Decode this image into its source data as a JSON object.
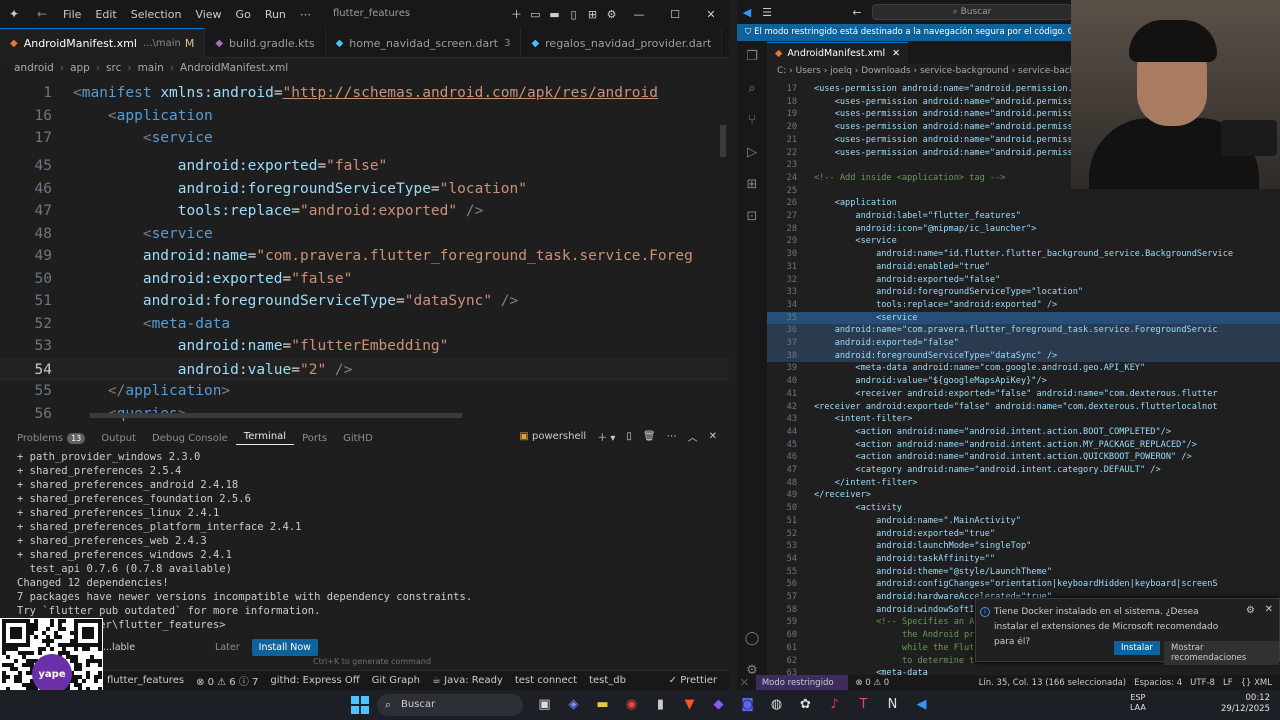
{
  "left_window": {
    "menu": [
      "File",
      "Edit",
      "Selection",
      "View",
      "Go",
      "Run",
      "⋯"
    ],
    "title": "flutter_features",
    "tabs": [
      {
        "label": "AndroidManifest.xml",
        "desc": "...\\main",
        "mod": "M"
      },
      {
        "label": "build.gradle.kts",
        "desc": "",
        "mod": ""
      },
      {
        "label": "home_navidad_screen.dart",
        "desc": "",
        "mod": "3"
      },
      {
        "label": "regalos_navidad_provider.dart",
        "desc": "",
        "mod": ""
      }
    ],
    "breadcrumb": [
      "android",
      "app",
      "src",
      "main",
      "AndroidManifest.xml"
    ],
    "code_lines": [
      {
        "n": "1",
        "parts": [
          [
            "t",
            "<"
          ],
          [
            "tag",
            "manifest "
          ],
          [
            "attr",
            "xmlns:android"
          ],
          [
            "eq",
            "="
          ],
          [
            "url",
            "\"http://schemas.android.com/apk/res/android"
          ]
        ]
      },
      {
        "n": "16",
        "parts": [
          [
            "t",
            "    <"
          ],
          [
            "tag",
            "application"
          ]
        ]
      },
      {
        "n": "17",
        "parts": [
          [
            "t",
            "        <"
          ],
          [
            "tag",
            "service"
          ]
        ]
      },
      {
        "n": "45",
        "parts": [
          [
            "attr",
            "            android:exported"
          ],
          [
            "eq",
            "="
          ],
          [
            "str",
            "\"false\""
          ]
        ]
      },
      {
        "n": "46",
        "parts": [
          [
            "attr",
            "            android:foregroundServiceType"
          ],
          [
            "eq",
            "="
          ],
          [
            "str",
            "\"location\""
          ]
        ]
      },
      {
        "n": "47",
        "parts": [
          [
            "attr",
            "            tools:replace"
          ],
          [
            "eq",
            "="
          ],
          [
            "str",
            "\"android:exported\""
          ],
          [
            "t",
            " />"
          ]
        ]
      },
      {
        "n": "48",
        "parts": [
          [
            "t",
            "        <"
          ],
          [
            "tag",
            "service"
          ]
        ]
      },
      {
        "n": "49",
        "parts": [
          [
            "attr",
            "        android:name"
          ],
          [
            "eq",
            "="
          ],
          [
            "str",
            "\"com.pravera.flutter_foreground_task.service.Foreg"
          ]
        ]
      },
      {
        "n": "50",
        "parts": [
          [
            "attr",
            "        android:exported"
          ],
          [
            "eq",
            "="
          ],
          [
            "str",
            "\"false\""
          ]
        ]
      },
      {
        "n": "51",
        "parts": [
          [
            "attr",
            "        android:foregroundServiceType"
          ],
          [
            "eq",
            "="
          ],
          [
            "str",
            "\"dataSync\""
          ],
          [
            "t",
            " />"
          ]
        ]
      },
      {
        "n": "52",
        "parts": [
          [
            "t",
            "        <"
          ],
          [
            "tag",
            "meta-data"
          ]
        ]
      },
      {
        "n": "53",
        "parts": [
          [
            "attr",
            "            android:name"
          ],
          [
            "eq",
            "="
          ],
          [
            "str",
            "\"flutterEmbedding\""
          ]
        ]
      },
      {
        "n": "54",
        "parts": [
          [
            "attr",
            "            android:value"
          ],
          [
            "eq",
            "="
          ],
          [
            "str",
            "\"2\""
          ],
          [
            "t",
            " />"
          ]
        ]
      },
      {
        "n": "55",
        "parts": [
          [
            "t",
            "    </"
          ],
          [
            "tag",
            "application"
          ],
          [
            "t",
            ">"
          ]
        ]
      },
      {
        "n": "56",
        "parts": [
          [
            "t",
            "    <"
          ],
          [
            "tag",
            "queries"
          ],
          [
            "t",
            ">"
          ]
        ]
      }
    ],
    "panel_tabs": [
      {
        "label": "Problems",
        "badge": "13"
      },
      {
        "label": "Output",
        "badge": ""
      },
      {
        "label": "Debug Console",
        "badge": ""
      },
      {
        "label": "Terminal",
        "badge": ""
      },
      {
        "label": "Ports",
        "badge": ""
      },
      {
        "label": "GitHD",
        "badge": ""
      }
    ],
    "terminal_shell": "powershell",
    "terminal_lines": [
      "+ path_provider_windows 2.3.0",
      "+ shared_preferences 2.5.4",
      "+ shared_preferences_android 2.4.18",
      "+ shared_preferences_foundation 2.5.6",
      "+ shared_preferences_linux 2.4.1",
      "+ shared_preferences_platform_interface 2.4.1",
      "+ shared_preferences_web 2.4.3",
      "+ shared_preferences_windows 2.4.1",
      "  test_api 0.7.6 (0.7.8 available)",
      "Changed 12 dependencies!",
      "7 packages have newer versions incompatible with dependency constraints.",
      "Try `flutter pub outdated` for more information.",
      "         ...ter\\flutter_features>"
    ],
    "ext_prompt": {
      "text": "...lable",
      "later": "Later",
      "install": "Install Now"
    },
    "hint": "Ctrl+K to generate command",
    "status": [
      "flutter_features",
      "⊗ 0  ⚠ 6  ⓘ 7",
      "githd: Express Off",
      "Git Graph",
      "☕ Java: Ready",
      "test connect",
      "test_db",
      "✓ Prettier"
    ]
  },
  "right_window": {
    "search": "Buscar",
    "banner": "El modo restringido está destinado a la navegación segura por el código. Confíe en esta v",
    "tab": "AndroidManifest.xml",
    "breadcrumb": "C: › Users › joelq › Downloads › service-background › service-backgroun",
    "code": [
      {
        "n": "17",
        "t": "<uses-permission android:name=\"android.permission.A",
        "c": "n"
      },
      {
        "n": "18",
        "t": "    <uses-permission android:name=\"android.permiss",
        "c": "n"
      },
      {
        "n": "19",
        "t": "    <uses-permission android:name=\"android.permiss",
        "c": "n"
      },
      {
        "n": "20",
        "t": "    <uses-permission android:name=\"android.permiss",
        "c": "n"
      },
      {
        "n": "21",
        "t": "    <uses-permission android:name=\"android.permiss",
        "c": "n"
      },
      {
        "n": "22",
        "t": "    <uses-permission android:name=\"android.permiss",
        "c": "n"
      },
      {
        "n": "23",
        "t": "",
        "c": "n"
      },
      {
        "n": "24",
        "t": "<!-- Add inside <application> tag -->",
        "c": "cm"
      },
      {
        "n": "25",
        "t": "",
        "c": "n"
      },
      {
        "n": "26",
        "t": "    <application",
        "c": "n"
      },
      {
        "n": "27",
        "t": "        android:label=\"flutter_features\"",
        "c": "n"
      },
      {
        "n": "28",
        "t": "        android:icon=\"@mipmap/ic_launcher\">",
        "c": "n"
      },
      {
        "n": "29",
        "t": "        <service",
        "c": "n"
      },
      {
        "n": "30",
        "t": "            android:name=\"id.flutter.flutter_background_service.BackgroundService",
        "c": "n"
      },
      {
        "n": "31",
        "t": "            android:enabled=\"true\"",
        "c": "n"
      },
      {
        "n": "32",
        "t": "            android:exported=\"false\"",
        "c": "n"
      },
      {
        "n": "33",
        "t": "            android:foregroundServiceType=\"location\"",
        "c": "n"
      },
      {
        "n": "34",
        "t": "            tools:replace=\"android:exported\" />",
        "c": "n"
      },
      {
        "n": "35",
        "t": "            <service",
        "c": "sel"
      },
      {
        "n": "36",
        "t": "    android:name=\"com.pravera.flutter_foreground_task.service.ForegroundServic",
        "c": "sel2"
      },
      {
        "n": "37",
        "t": "    android:exported=\"false\"",
        "c": "sel2"
      },
      {
        "n": "38",
        "t": "    android:foregroundServiceType=\"dataSync\" />",
        "c": "sel2"
      },
      {
        "n": "39",
        "t": "        <meta-data android:name=\"com.google.android.geo.API_KEY\"",
        "c": "n"
      },
      {
        "n": "40",
        "t": "        android:value=\"${googleMapsApiKey}\"/>",
        "c": "n"
      },
      {
        "n": "41",
        "t": "        <receiver android:exported=\"false\" android:name=\"com.dexterous.flutter",
        "c": "n"
      },
      {
        "n": "42",
        "t": "<receiver android:exported=\"false\" android:name=\"com.dexterous.flutterlocalnot",
        "c": "n"
      },
      {
        "n": "43",
        "t": "    <intent-filter>",
        "c": "n"
      },
      {
        "n": "44",
        "t": "        <action android:name=\"android.intent.action.BOOT_COMPLETED\"/>",
        "c": "n"
      },
      {
        "n": "45",
        "t": "        <action android:name=\"android.intent.action.MY_PACKAGE_REPLACED\"/>",
        "c": "n"
      },
      {
        "n": "46",
        "t": "        <action android:name=\"android.intent.action.QUICKBOOT_POWERON\" />",
        "c": "n"
      },
      {
        "n": "47",
        "t": "        <category android:name=\"android.intent.category.DEFAULT\" />",
        "c": "n"
      },
      {
        "n": "48",
        "t": "    </intent-filter>",
        "c": "n"
      },
      {
        "n": "49",
        "t": "</receiver>",
        "c": "n"
      },
      {
        "n": "50",
        "t": "        <activity",
        "c": "n"
      },
      {
        "n": "51",
        "t": "            android:name=\".MainActivity\"",
        "c": "n"
      },
      {
        "n": "52",
        "t": "            android:exported=\"true\"",
        "c": "n"
      },
      {
        "n": "53",
        "t": "            android:launchMode=\"singleTop\"",
        "c": "n"
      },
      {
        "n": "54",
        "t": "            android:taskAffinity=\"\"",
        "c": "n"
      },
      {
        "n": "55",
        "t": "            android:theme=\"@style/LaunchTheme\"",
        "c": "n"
      },
      {
        "n": "56",
        "t": "            android:configChanges=\"orientation|keyboardHidden|keyboard|screenS",
        "c": "n"
      },
      {
        "n": "57",
        "t": "            android:hardwareAccelerated=\"true\"",
        "c": "n"
      },
      {
        "n": "58",
        "t": "            android:windowSoftI",
        "c": "n"
      },
      {
        "n": "59",
        "t": "            <!-- Specifies an A",
        "c": "cm"
      },
      {
        "n": "60",
        "t": "                 the Android pr",
        "c": "cm"
      },
      {
        "n": "61",
        "t": "                 while the Flut",
        "c": "cm"
      },
      {
        "n": "62",
        "t": "                 to determine t",
        "c": "cm"
      },
      {
        "n": "63",
        "t": "            <meta-data",
        "c": "n"
      }
    ],
    "notification": {
      "text": "Tiene Docker instalado en el sistema. ¿Desea instalar el extensiones de Microsoft recomendado para él?",
      "install": "Instalar",
      "show": "Mostrar recomendaciones"
    },
    "status": {
      "mode": "Modo restringido",
      "problems": "⊗ 0 ⚠ 0",
      "pos": "Lín. 35, Col. 13 (166 seleccionada)",
      "spaces": "Espacios: 4",
      "enc": "UTF-8",
      "eol": "LF",
      "lang": "{} XML"
    }
  },
  "taskbar": {
    "search": "Buscar",
    "lang": "ESP",
    "region": "LAA",
    "time": "00:12",
    "date": "29/12/2025"
  }
}
